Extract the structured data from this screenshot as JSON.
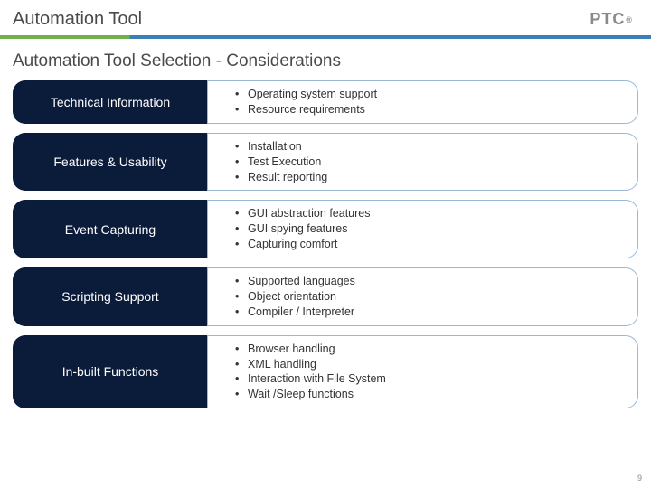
{
  "header": {
    "title": "Automation Tool",
    "logo_text": "PTC",
    "logo_reg": "®"
  },
  "subtitle": "Automation Tool Selection - Considerations",
  "rows": [
    {
      "label": "Technical Information",
      "items": [
        "Operating system support",
        "Resource requirements"
      ]
    },
    {
      "label": "Features & Usability",
      "items": [
        "Installation",
        "Test Execution",
        "Result reporting"
      ]
    },
    {
      "label": "Event Capturing",
      "items": [
        "GUI abstraction features",
        "GUI spying features",
        "Capturing comfort"
      ]
    },
    {
      "label": "Scripting Support",
      "items": [
        "Supported languages",
        "Object orientation",
        "Compiler / Interpreter"
      ]
    },
    {
      "label": "In-built Functions",
      "items": [
        "Browser handling",
        "XML handling",
        "Interaction with File System",
        "Wait /Sleep functions"
      ]
    }
  ],
  "page_number": "9"
}
